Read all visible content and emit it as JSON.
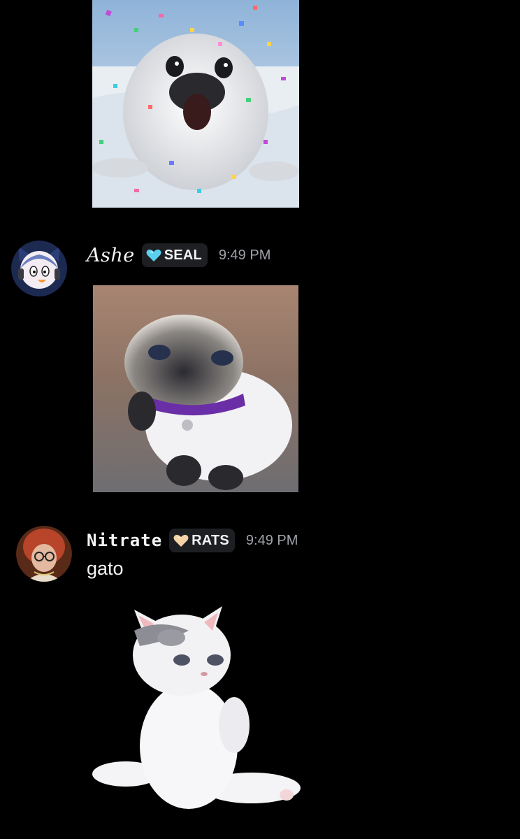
{
  "messages": [
    {
      "author": "",
      "attachment": {
        "icon": "seal-confetti-image",
        "alt": ""
      }
    },
    {
      "author": "Ashe",
      "tag": {
        "icon": "blue-heart-icon",
        "label": "SEAL"
      },
      "time": "9:49 PM",
      "avatar_icon": "anime-character-avatar",
      "attachment": {
        "icon": "siamese-kitten-image",
        "alt": ""
      }
    },
    {
      "author": "Nitrate",
      "tag": {
        "icon": "tan-heart-icon",
        "label": "RATS"
      },
      "time": "9:49 PM",
      "avatar_icon": "person-with-red-hair-avatar",
      "text": "gato",
      "attachment": {
        "icon": "white-cat-sitting-image",
        "alt": ""
      }
    }
  ],
  "colors": {
    "background": "#000000",
    "tag_background": "#1e1f22",
    "username": "#f2f3f5",
    "timestamp": "#a0a3aa",
    "blue_heart": "#5ad1f0",
    "tan_heart": "#f5d3a6"
  }
}
